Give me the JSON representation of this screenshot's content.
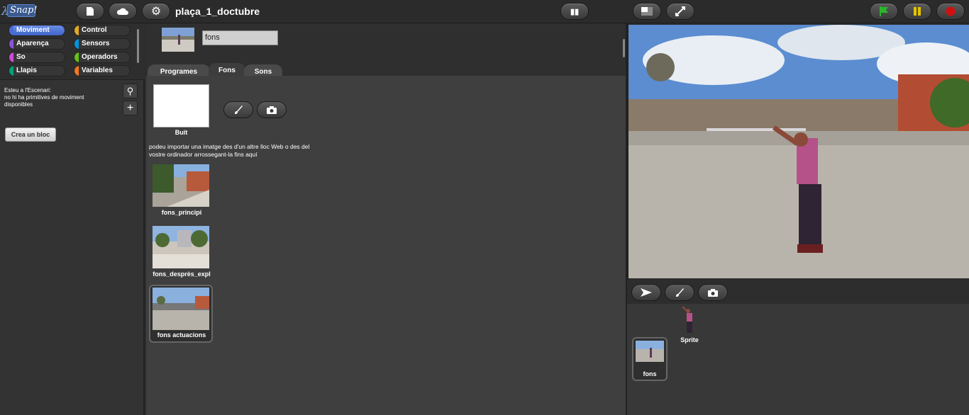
{
  "app": {
    "logo_text": "Snap!",
    "project_name": "plaça_1_doctubre"
  },
  "colors": {
    "flag": "#2cb52c",
    "pause": "#e2c400",
    "stop": "#d01010",
    "selected_category": "#4f73d6"
  },
  "palette": {
    "categories": [
      {
        "label": "Moviment",
        "color": "#4a6cd4"
      },
      {
        "label": "Control",
        "color": "#e6a822"
      },
      {
        "label": "Aparença",
        "color": "#8a55d7"
      },
      {
        "label": "Sensors",
        "color": "#0494dc"
      },
      {
        "label": "So",
        "color": "#cf4ad9"
      },
      {
        "label": "Operadors",
        "color": "#62c213"
      },
      {
        "label": "Llapis",
        "color": "#00a178"
      },
      {
        "label": "Variables",
        "color": "#f3761d"
      }
    ],
    "stage_notice": "Esteu a l'Escenari:\nno hi ha primitives de moviment\ndisponibles",
    "make_block_label": "Crea un bloc"
  },
  "sprite": {
    "name": "fons"
  },
  "tabs": [
    "Programes",
    "Fons",
    "Sons"
  ],
  "costumes": {
    "blank_label": "Buit",
    "import_hint": "podeu importar una imatge des d'un altre lloc Web o des del\nvostre ordinador arrossegant-la fins aquí",
    "items": [
      "fons_principi",
      "fons_desprès_expl",
      "fons actuacions"
    ]
  },
  "corral": {
    "stage_label": "fons",
    "sprite_label": "Sprite"
  }
}
